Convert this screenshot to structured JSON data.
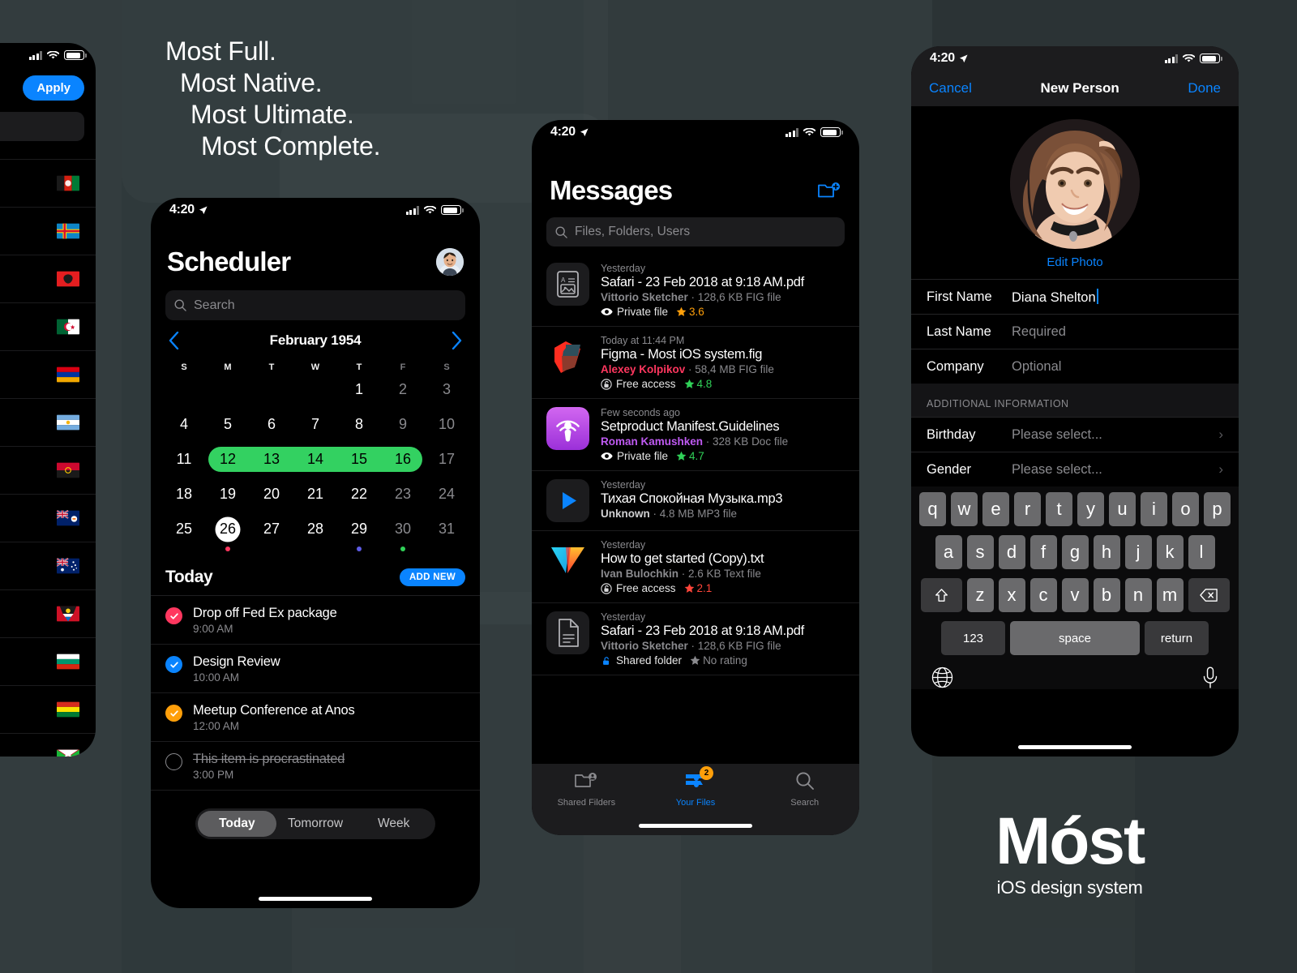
{
  "hero": {
    "lines": [
      "Most Full.",
      "Most Native.",
      "Most Ultimate.",
      "Most Complete."
    ]
  },
  "logo": {
    "word": "Móst",
    "subtitle": "iOS design system"
  },
  "colors": {
    "accent_blue": "#0a84ff",
    "green": "#33d161",
    "orange": "#ff9f0a",
    "red": "#ff375f",
    "background": "#2e3638",
    "phone_bg": "#000000"
  },
  "phone_left": {
    "status": {
      "time": "",
      "icons": [
        "cellular-bars",
        "wifi",
        "battery"
      ]
    },
    "apply_label": "Apply",
    "search_placeholder": "",
    "flags": [
      {
        "name": "Afghanistan"
      },
      {
        "name": "Aland Islands"
      },
      {
        "name": "Albania"
      },
      {
        "name": "Algeria"
      },
      {
        "name": "Armenia"
      },
      {
        "name": "Argentina"
      },
      {
        "name": "Angola"
      },
      {
        "name": "Anguilla"
      },
      {
        "name": "Australia"
      },
      {
        "name": "Antigua and Barbuda"
      },
      {
        "name": "Bulgaria"
      },
      {
        "name": "Bolivia"
      },
      {
        "name": "Burundi"
      }
    ]
  },
  "scheduler": {
    "status": {
      "time": "4:20"
    },
    "title": "Scheduler",
    "search_placeholder": "Search",
    "month": "February 1954",
    "prev_label": "‹",
    "next_label": "›",
    "weekdays": [
      "S",
      "M",
      "T",
      "W",
      "T",
      "F",
      "S"
    ],
    "weeks": [
      [
        {
          "d": ""
        },
        {
          "d": ""
        },
        {
          "d": ""
        },
        {
          "d": ""
        },
        {
          "d": "1"
        },
        {
          "d": "2",
          "dim": true
        },
        {
          "d": "3",
          "dim": true
        }
      ],
      [
        {
          "d": "4"
        },
        {
          "d": "5"
        },
        {
          "d": "6"
        },
        {
          "d": "7"
        },
        {
          "d": "8"
        },
        {
          "d": "9",
          "dim": true
        },
        {
          "d": "10",
          "dim": true
        }
      ],
      [
        {
          "d": "11"
        },
        {
          "d": "12",
          "sel": true
        },
        {
          "d": "13",
          "sel": true
        },
        {
          "d": "14",
          "sel": true
        },
        {
          "d": "15",
          "sel": true
        },
        {
          "d": "16",
          "sel": true
        },
        {
          "d": "17",
          "dim": true
        }
      ],
      [
        {
          "d": "18"
        },
        {
          "d": "19"
        },
        {
          "d": "20"
        },
        {
          "d": "21"
        },
        {
          "d": "22"
        },
        {
          "d": "23",
          "dim": true
        },
        {
          "d": "24",
          "dim": true
        }
      ],
      [
        {
          "d": "25"
        },
        {
          "d": "26",
          "today": true
        },
        {
          "d": "27"
        },
        {
          "d": "28"
        },
        {
          "d": "29"
        },
        {
          "d": "30",
          "dim": true
        },
        {
          "d": "31",
          "dim": true
        }
      ]
    ],
    "event_dots": [
      {
        "col": 1,
        "color": "#ff375f"
      },
      {
        "col": 4,
        "color": "#5e5ce6"
      },
      {
        "col": 5,
        "color": "#30d158"
      }
    ],
    "today_header": "Today",
    "add_new_label": "ADD NEW",
    "tasks": [
      {
        "title": "Drop off Fed Ex package",
        "time": "9:00 AM",
        "state": "checked",
        "color": "#ff375f"
      },
      {
        "title": "Design Review",
        "time": "10:00 AM",
        "state": "checked",
        "color": "#0a84ff"
      },
      {
        "title": "Meetup Conference at Anos",
        "time": "12:00 AM",
        "state": "checked",
        "color": "#ff9f0a"
      },
      {
        "title": "This item is procrastinated",
        "time": "3:00 PM",
        "state": "empty",
        "color": ""
      }
    ],
    "segments": [
      {
        "label": "Today",
        "active": true
      },
      {
        "label": "Tomorrow",
        "active": false
      },
      {
        "label": "Week",
        "active": false
      }
    ]
  },
  "messages": {
    "status": {
      "time": "4:20"
    },
    "title": "Messages",
    "new_folder_icon": "folder-plus-icon",
    "search_placeholder": "Files, Folders, Users",
    "items": [
      {
        "time": "Yesterday",
        "name": "Safari - 23 Feb 2018 at 9:18 AM.pdf",
        "owner": "Vittorio Sketcher",
        "owner_color": "#8a8a8e",
        "size": "128,6 KB FIG file",
        "access": "Private file",
        "access_icon": "eye-icon",
        "rating": "3.6",
        "rating_color": "#ff9f0a",
        "icon": "doc-image-icon"
      },
      {
        "time": "Today at 11:44 PM",
        "name": "Figma - Most iOS system.fig",
        "owner": "Alexey Kolpikov",
        "owner_color": "#ff375f",
        "size": "58,4 MB FIG file",
        "access": "Free access",
        "access_icon": "unlock-circle-icon",
        "rating": "4.8",
        "rating_color": "#30d158",
        "icon": "figma-icon"
      },
      {
        "time": "Few seconds ago",
        "name": "Setproduct Manifest.Guidelines",
        "owner": "Roman Kamushken",
        "owner_color": "#bf5af2",
        "size": "328 KB Doc file",
        "access": "Private file",
        "access_icon": "eye-icon",
        "rating": "4.7",
        "rating_color": "#30d158",
        "icon": "podcast-icon"
      },
      {
        "time": "Yesterday",
        "name": "Тихая Спокойная Музыка.mp3",
        "owner": "Unknown",
        "owner_color": "#d0d0d2",
        "size": "4.8 MB MP3 file",
        "access": "",
        "access_icon": "",
        "rating": "",
        "rating_color": "",
        "icon": "play-icon"
      },
      {
        "time": "Yesterday",
        "name": "How to get started (Copy).txt",
        "owner": "Ivan Bulochkin",
        "owner_color": "#8a8a8e",
        "size": "2.6 KB Text file",
        "access": "Free access",
        "access_icon": "unlock-circle-icon",
        "rating": "2.1",
        "rating_color": "#ff453a",
        "icon": "triangle-icon"
      },
      {
        "time": "Yesterday",
        "name": "Safari - 23 Feb 2018 at 9:18 AM.pdf",
        "owner": "Vittorio Sketcher",
        "owner_color": "#8a8a8e",
        "size": "128,6 KB FIG file",
        "access": "Shared folder",
        "access_icon": "unlock-blue-icon",
        "rating": "No rating",
        "rating_color": "#8a8a8e",
        "icon": "document-icon"
      }
    ],
    "tabs": [
      {
        "label": "Shared Filders",
        "icon": "shared-folder-icon",
        "active": false,
        "badge": ""
      },
      {
        "label": "Your Files",
        "icon": "tray-icon",
        "active": true,
        "badge": "2"
      },
      {
        "label": "Search",
        "icon": "search-icon",
        "active": false,
        "badge": ""
      }
    ]
  },
  "new_person": {
    "status": {
      "time": "4:20"
    },
    "cancel_label": "Cancel",
    "title": "New Person",
    "done_label": "Done",
    "edit_photo_label": "Edit Photo",
    "fields": [
      {
        "label": "First Name",
        "value": "Diana Shelton",
        "placeholder": false,
        "caret": true
      },
      {
        "label": "Last Name",
        "value": "Required",
        "placeholder": true,
        "caret": false
      },
      {
        "label": "Company",
        "value": "Optional",
        "placeholder": true,
        "caret": false
      }
    ],
    "section_header": "ADDITIONAL INFORMATION",
    "extra_fields": [
      {
        "label": "Birthday",
        "value": "Please select...",
        "chevron": "›"
      },
      {
        "label": "Gender",
        "value": "Please select...",
        "chevron": "›"
      }
    ],
    "keyboard": {
      "row1": [
        "q",
        "w",
        "e",
        "r",
        "t",
        "y",
        "u",
        "i",
        "o",
        "p"
      ],
      "row2": [
        "a",
        "s",
        "d",
        "f",
        "g",
        "h",
        "j",
        "k",
        "l"
      ],
      "row3": [
        "z",
        "x",
        "c",
        "v",
        "b",
        "n",
        "m"
      ],
      "shift_icon": "shift-icon",
      "backspace_icon": "backspace-icon",
      "numbers_label": "123",
      "space_label": "space",
      "return_label": "return",
      "globe_icon": "globe-icon",
      "mic_icon": "microphone-icon"
    }
  }
}
